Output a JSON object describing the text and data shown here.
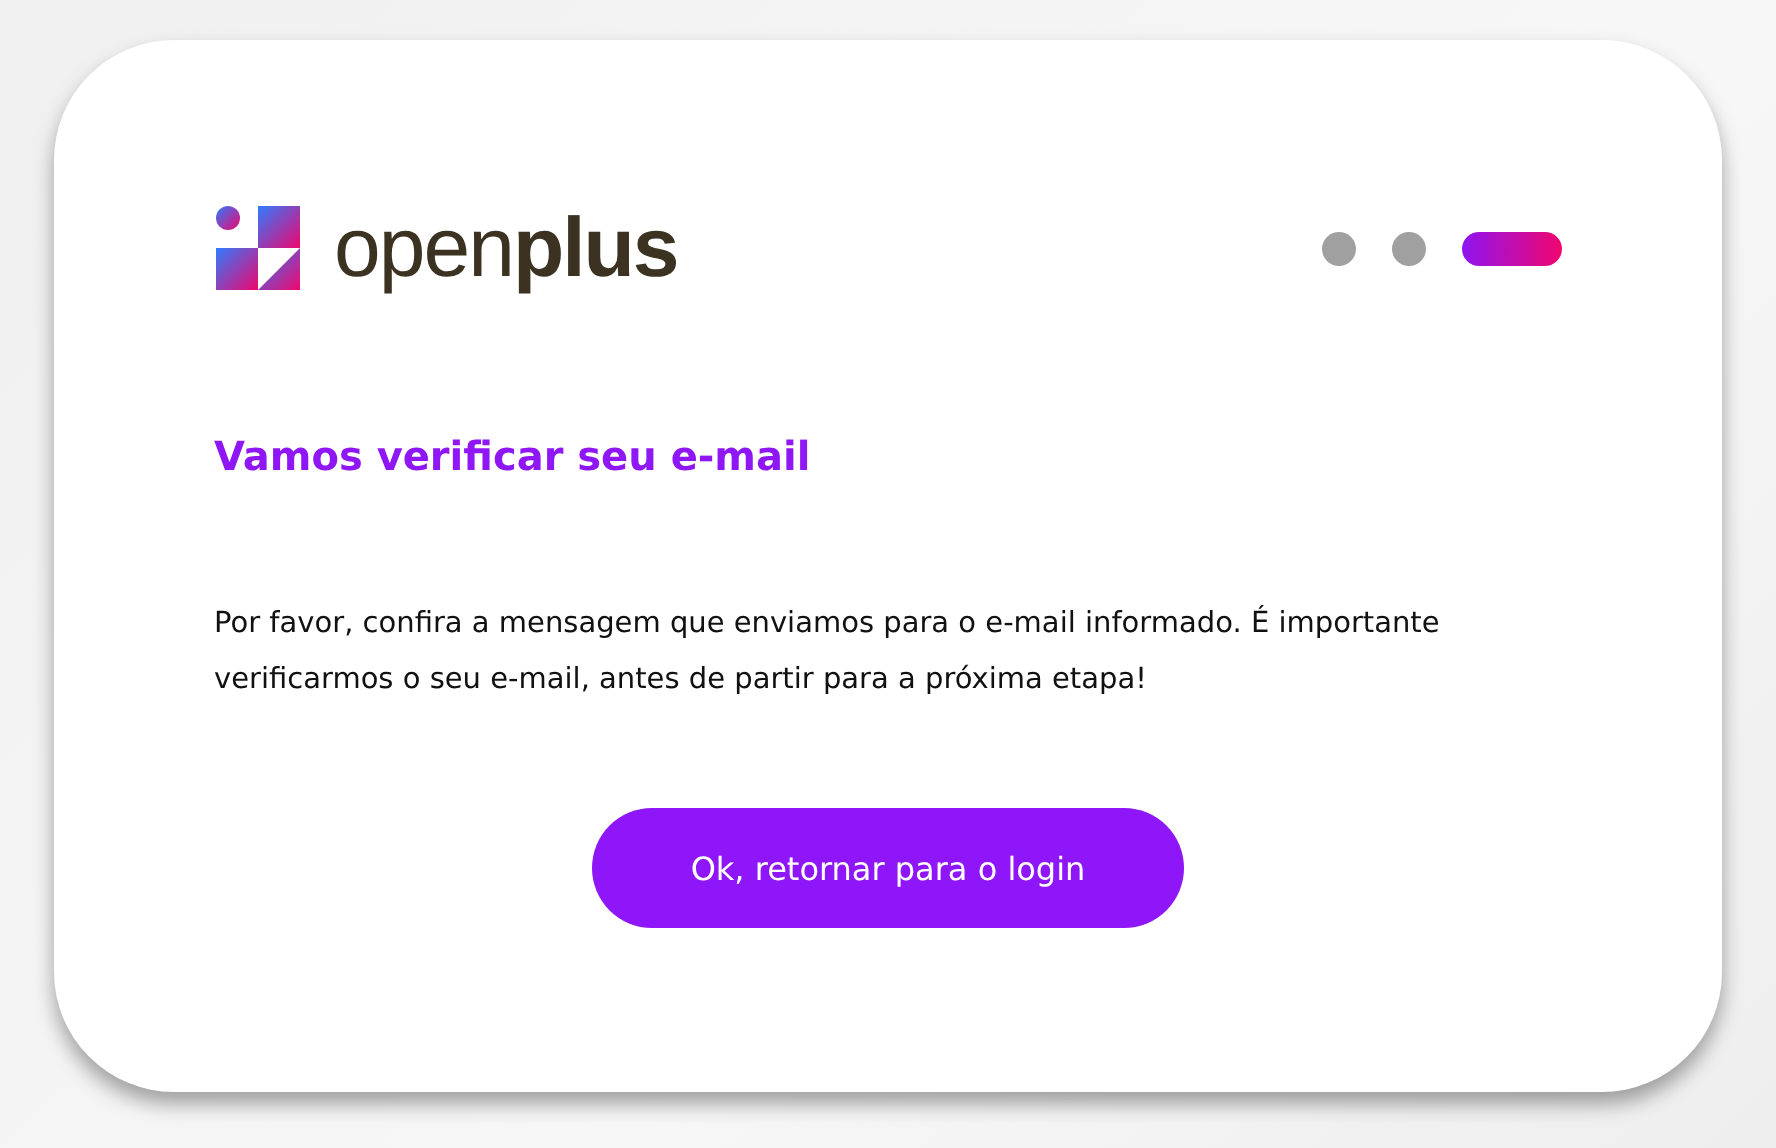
{
  "brand": {
    "name": "open**plus**"
  },
  "steps": [
    {
      "selected": false
    },
    {
      "selected": false
    },
    {
      "selected": true
    }
  ],
  "title": "Vamos verificar seu e-mail",
  "message": "Por favor, confira a mensagem que enviamos para o e-mail informado. É importante verificarmos o seu e-mail, antes de partir para a próxima etapa!",
  "button": "Ok, retornar para o login"
}
